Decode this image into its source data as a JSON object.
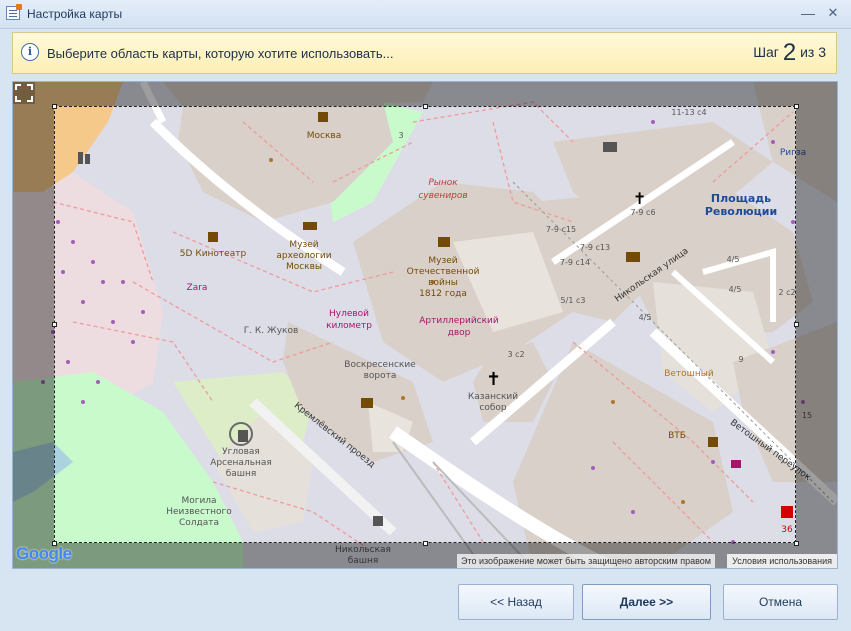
{
  "window": {
    "title": "Настройка карты",
    "minimize_glyph": "—",
    "close_glyph": "✕"
  },
  "infobar": {
    "message": "Выберите область карты, которую хотите использовать...",
    "step_prefix": "Шаг",
    "step_current": "2",
    "step_sep": "из",
    "step_total": "3"
  },
  "map": {
    "labels": {
      "moskva": "Москва",
      "rynok_1": "Рынок",
      "rynok_2": "сувениров",
      "ploshchad_1": "Площадь",
      "ploshchad_2": "Революции",
      "ploshchad_badge": "Ригза",
      "muzey_arh_1": "Музей",
      "muzey_arh_2": "археологии",
      "muzey_arh_3": "Москвы",
      "kino": "5D Кинотеатр",
      "zara": "Zara",
      "zhukov": "Г. К. Жуков",
      "muzey_ov_1": "Музей",
      "muzey_ov_2": "Отечественной",
      "muzey_ov_3": "войны",
      "muzey_ov_4": "1812 года",
      "nulevoy_1": "Нулевой",
      "nulevoy_2": "километр",
      "art_1": "Артиллерийский",
      "art_2": "двор",
      "vorota_1": "Воскресенские",
      "vorota_2": "ворота",
      "kazan_1": "Казанский",
      "kazan_2": "собор",
      "nikolskaya": "Никольская улица",
      "vetoshny_lane": "Ветошный переулок",
      "vetoshny": "Ветошный",
      "vtb": "ВТБ",
      "kreml_proezd": "Кремлёвский проезд",
      "arsenal_1": "Угловая",
      "arsenal_2": "Арсенальная",
      "arsenal_3": "башня",
      "mogila_1": "Могила",
      "mogila_2": "Неизвестного",
      "mogila_3": "Солдата",
      "nik_bashnya_1": "Никольская",
      "nik_bashnya_2": "башня",
      "c7_9c15": "7-9 с15",
      "c7_9c13": "7-9 с13",
      "c7_9c14": "7-9 с14",
      "c7_9c6": "7-9 с6",
      "c5_1c3": "5/1 с3",
      "c3c2": "3 с2",
      "c4_5a": "4/5",
      "c4_5b": "4/5",
      "c4_5c": "4/5",
      "c2c2": "2 с2",
      "c9": "9",
      "c11_13": "11-13 с4",
      "c3": "3",
      "c15": "15",
      "c36": "36"
    },
    "google": "Google",
    "copyright": "Это изображение может быть защищено авторским правом",
    "terms": "Условия использования"
  },
  "buttons": {
    "back": "<< Назад",
    "next": "Далее >>",
    "cancel": "Отмена"
  },
  "colors": {
    "window_bg": "#d7e4f2",
    "infobar_bg": "#fcefb4",
    "map_building": "#d9d0c9",
    "map_road": "#f7f7f7",
    "map_pedestrian": "#dddde8",
    "map_park": "#c8facc",
    "map_label_brown": "#734a08",
    "map_label_red": "#c23a3a",
    "map_label_purple": "#a5156b"
  }
}
